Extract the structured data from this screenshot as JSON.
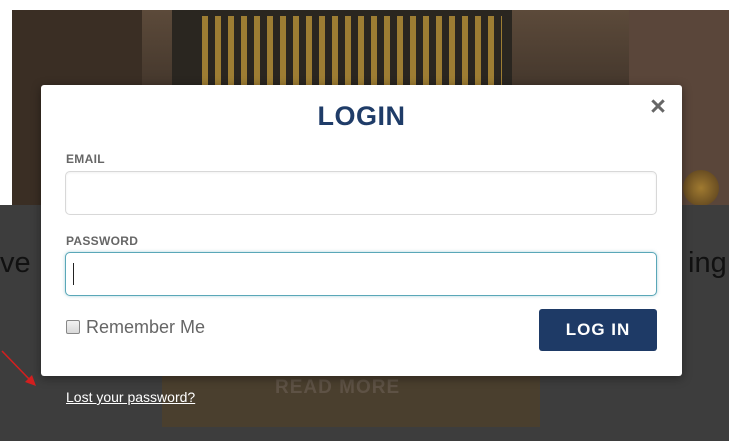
{
  "background": {
    "left_text": "ve",
    "right_text": "ing",
    "read_more": "READ MORE"
  },
  "modal": {
    "title": "LOGIN",
    "close_icon": "close-icon",
    "email": {
      "label": "EMAIL",
      "value": "",
      "placeholder": ""
    },
    "password": {
      "label": "PASSWORD",
      "value": "",
      "placeholder": ""
    },
    "remember": {
      "label": "Remember Me",
      "checked": false
    },
    "login_button": "LOG IN"
  },
  "lost_password_link": "Lost your password?",
  "colors": {
    "title": "#1f3c68",
    "button": "#1e3a66",
    "focus_border": "#5aa7b8",
    "annotation_arrow": "#d21f1f"
  }
}
